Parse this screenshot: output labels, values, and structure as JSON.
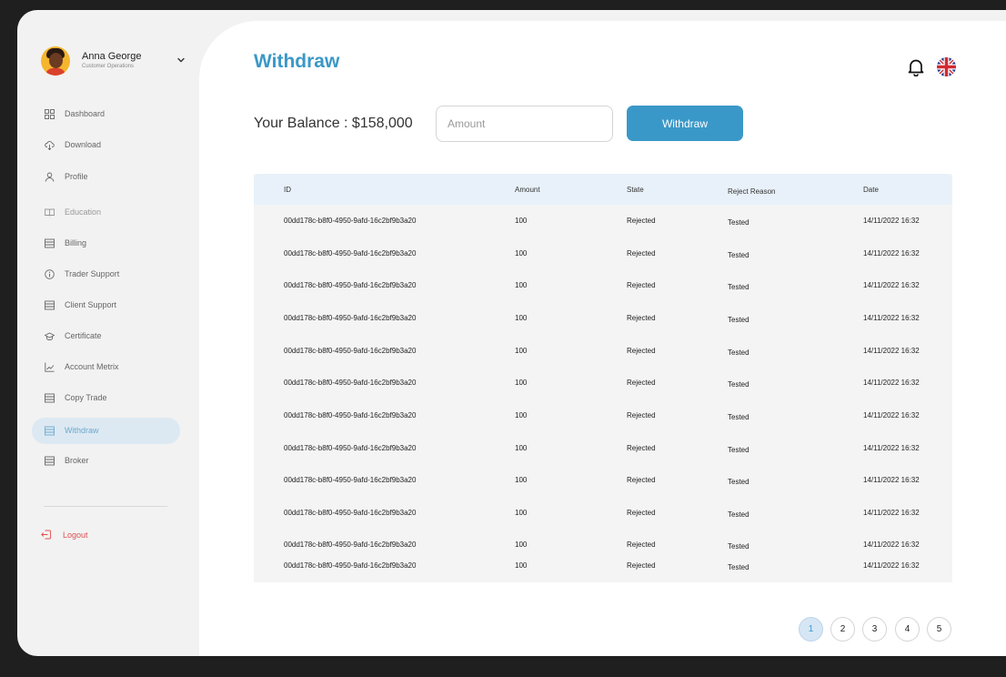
{
  "user": {
    "name": "Anna George",
    "role": "Customer Operations"
  },
  "sidebar": {
    "items": [
      {
        "label": "Dashboard",
        "icon": "grid-icon",
        "active": false
      },
      {
        "label": "Download",
        "icon": "cloud-download-icon",
        "active": false
      },
      {
        "label": "Profile",
        "icon": "user-icon",
        "active": false
      },
      {
        "label": "Education",
        "icon": "book-icon",
        "active": false
      },
      {
        "label": "Billing",
        "icon": "list-icon",
        "active": false
      },
      {
        "label": "Trader Support",
        "icon": "info-icon",
        "active": false
      },
      {
        "label": "Client Support",
        "icon": "list-icon",
        "active": false
      },
      {
        "label": "Certificate",
        "icon": "graduation-cap-icon",
        "active": false
      },
      {
        "label": "Account Metrix",
        "icon": "chart-icon",
        "active": false
      },
      {
        "label": "Copy Trade",
        "icon": "list-icon",
        "active": false
      },
      {
        "label": "Withdraw",
        "icon": "list-icon",
        "active": true
      },
      {
        "label": "Broker",
        "icon": "list-icon",
        "active": false
      }
    ],
    "logout_label": "Logout"
  },
  "page": {
    "title": "Withdraw",
    "balance_label": "Your Balance : $158,000",
    "amount_placeholder": "Amount",
    "withdraw_button": "Withdraw"
  },
  "table": {
    "columns": [
      "ID",
      "Amount",
      "State",
      "Reject Reason",
      "Date"
    ],
    "rows": [
      {
        "id": "00dd178c-b8f0-4950-9afd-16c2bf9b3a20",
        "amount": "100",
        "state": "Rejected",
        "reason": "Tested",
        "date": "14/11/2022 16:32"
      },
      {
        "id": "00dd178c-b8f0-4950-9afd-16c2bf9b3a20",
        "amount": "100",
        "state": "Rejected",
        "reason": "Tested",
        "date": "14/11/2022 16:32"
      },
      {
        "id": "00dd178c-b8f0-4950-9afd-16c2bf9b3a20",
        "amount": "100",
        "state": "Rejected",
        "reason": "Tested",
        "date": "14/11/2022 16:32"
      },
      {
        "id": "00dd178c-b8f0-4950-9afd-16c2bf9b3a20",
        "amount": "100",
        "state": "Rejected",
        "reason": "Tested",
        "date": "14/11/2022 16:32"
      },
      {
        "id": "00dd178c-b8f0-4950-9afd-16c2bf9b3a20",
        "amount": "100",
        "state": "Rejected",
        "reason": "Tested",
        "date": "14/11/2022 16:32"
      },
      {
        "id": "00dd178c-b8f0-4950-9afd-16c2bf9b3a20",
        "amount": "100",
        "state": "Rejected",
        "reason": "Tested",
        "date": "14/11/2022 16:32"
      },
      {
        "id": "00dd178c-b8f0-4950-9afd-16c2bf9b3a20",
        "amount": "100",
        "state": "Rejected",
        "reason": "Tested",
        "date": "14/11/2022 16:32"
      },
      {
        "id": "00dd178c-b8f0-4950-9afd-16c2bf9b3a20",
        "amount": "100",
        "state": "Rejected",
        "reason": "Tested",
        "date": "14/11/2022 16:32"
      },
      {
        "id": "00dd178c-b8f0-4950-9afd-16c2bf9b3a20",
        "amount": "100",
        "state": "Rejected",
        "reason": "Tested",
        "date": "14/11/2022 16:32"
      },
      {
        "id": "00dd178c-b8f0-4950-9afd-16c2bf9b3a20",
        "amount": "100",
        "state": "Rejected",
        "reason": "Tested",
        "date": "14/11/2022 16:32"
      },
      {
        "id": "00dd178c-b8f0-4950-9afd-16c2bf9b3a20",
        "amount": "100",
        "state": "Rejected",
        "reason": "Tested",
        "date": "14/11/2022 16:32"
      },
      {
        "id": "00dd178c-b8f0-4950-9afd-16c2bf9b3a20",
        "amount": "100",
        "state": "Rejected",
        "reason": "Tested",
        "date": "14/11/2022 16:32"
      }
    ]
  },
  "pagination": {
    "pages": [
      "1",
      "2",
      "3",
      "4",
      "5"
    ],
    "current": "1"
  },
  "colors": {
    "accent": "#3a98c8",
    "active_nav_bg": "#dde9f2",
    "logout": "#e05050",
    "table_header_bg": "#e8f1f9"
  },
  "header_icons": [
    "bell-icon",
    "uk-flag-icon"
  ]
}
